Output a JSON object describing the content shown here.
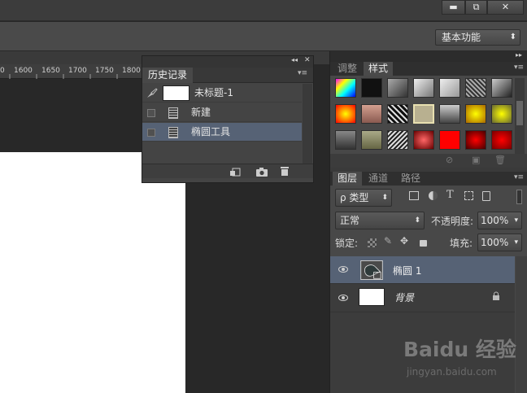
{
  "window": {
    "btn_min": "▬",
    "btn_restore": "⧉",
    "btn_close": "✕"
  },
  "options_bar": {
    "workspace_label": "基本功能"
  },
  "ruler": {
    "ticks": [
      "0",
      "1600",
      "1650",
      "1700",
      "1750",
      "1800"
    ]
  },
  "history_panel": {
    "tab": "历史记录",
    "collapse_glyph": "◂◂",
    "close_glyph": "✕",
    "menu_glyph": "▾≡",
    "snapshot_label": "未标题-1",
    "items": [
      {
        "label": "新建"
      },
      {
        "label": "椭圆工具"
      }
    ]
  },
  "styles_panel": {
    "tabs": [
      "调整",
      "样式"
    ],
    "active_tab": "样式"
  },
  "layers_panel": {
    "tabs": [
      "图层",
      "通道",
      "路径"
    ],
    "filter_label": "ρ 类型",
    "blend_mode": "正常",
    "opacity_label": "不透明度:",
    "opacity_value": "100%",
    "lock_label": "锁定:",
    "fill_label": "填充:",
    "fill_value": "100%",
    "layers": [
      {
        "name": "椭圆 1",
        "selected": true
      },
      {
        "name": "背景",
        "selected": false,
        "locked": true
      }
    ]
  },
  "watermark": {
    "brand": "Baidu 经验",
    "url": "jingyan.baidu.com"
  },
  "colors": {
    "selection": "#566275",
    "panel": "#484848",
    "accent_red": "#ff0000"
  }
}
